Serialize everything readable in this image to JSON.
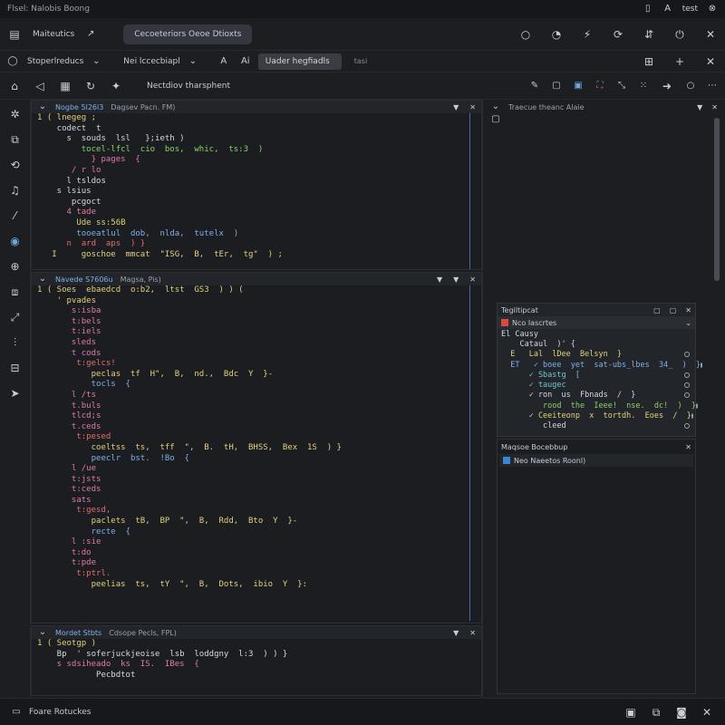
{
  "window": {
    "title": "Flsel: Nalobis Boong",
    "controls": [
      "▯",
      "A",
      "test",
      "⊗"
    ]
  },
  "menubar": {
    "label": "Maiteutics",
    "arrow_icon": "arrow-icon",
    "tab": "Cecoeteriors Oeoe Dtioxts"
  },
  "toolbar1": {
    "dropdown": "Stoperlreducs",
    "field_label": "Nei lccecbiapl",
    "input_value": "Uader hegfiadls",
    "extra": "tasi"
  },
  "toolbar2": {
    "label": "Nectdiov tharsphent"
  },
  "panes": [
    {
      "tab": "Nogbe 5l26l3",
      "info": "Dagsev  Pacn.  FM)",
      "lines": [
        [
          {
            "t": "1 ( lnegeg ;",
            "c": "c-yellow"
          }
        ],
        [
          {
            "t": "    codect  t",
            "c": "c-white"
          }
        ],
        [
          {
            "t": "      s  souds  lsl   };ieth )",
            "c": "c-white"
          }
        ],
        [
          {
            "t": "         tocel-lfcl  cio  bos,  whic,  ts:3  )",
            "c": "c-green"
          }
        ],
        [
          {
            "t": "           } pages  {",
            "c": "c-pink"
          }
        ],
        [
          {
            "t": "       / r lo",
            "c": "c-pink"
          }
        ],
        [
          {
            "t": "      l tsldos",
            "c": "c-white"
          }
        ],
        [
          {
            "t": "    s lsius",
            "c": "c-white"
          }
        ],
        [
          {
            "t": "       pcgoct",
            "c": "c-white"
          }
        ],
        [
          {
            "t": "      4 tade",
            "c": "c-pink"
          }
        ],
        [
          {
            "t": "        Ude ss:56B",
            "c": "c-yellow"
          }
        ],
        [
          {
            "t": "        tooeatlul  dob,  nlda,  tutelx  )",
            "c": "c-blue"
          }
        ],
        [
          {
            "t": "      n  ard  aps  ) }",
            "c": "c-red"
          }
        ],
        [
          {
            "t": "   I     goschoe  mmcat  \"ISG,  B,  tEr,  tg\"  ) ;",
            "c": "c-yellow"
          }
        ]
      ]
    },
    {
      "tab": "Navede S7606u",
      "info": "Magsa,  Pis)",
      "lines": [
        [
          {
            "t": "1 ( Soes  ebaedcd  o:b2,  ltst  GS3  ) ) (",
            "c": "c-yellow"
          }
        ],
        [
          {
            "t": "    ' pvades",
            "c": "c-yellow"
          }
        ],
        [
          {
            "t": "       s:isba",
            "c": "c-pink"
          }
        ],
        [
          {
            "t": "       t:bels",
            "c": "c-pink"
          }
        ],
        [
          {
            "t": "       t:iels",
            "c": "c-pink"
          }
        ],
        [
          {
            "t": "       sleds",
            "c": "c-pink"
          }
        ],
        [
          {
            "t": "       t cods",
            "c": "c-pink"
          }
        ],
        [
          {
            "t": "        t:gelcs!",
            "c": "c-red"
          }
        ],
        [
          {
            "t": "           peclas  tf  H\",  B,  nd.,  Bdc  Y  }-",
            "c": "c-yellow"
          }
        ],
        [
          {
            "t": "           tocls  {",
            "c": "c-blue"
          }
        ],
        [
          {
            "t": "       l /ts",
            "c": "c-pink"
          }
        ],
        [
          {
            "t": "       t.buls",
            "c": "c-pink"
          }
        ],
        [
          {
            "t": "       tlcd;s",
            "c": "c-pink"
          }
        ],
        [
          {
            "t": "       t.ceds",
            "c": "c-pink"
          }
        ],
        [
          {
            "t": "        t:pesed",
            "c": "c-red"
          }
        ],
        [
          {
            "t": "           coeltss  ts,  tff  \",  B.  tH,  BHSS,  Bex  1S  ) }",
            "c": "c-yellow"
          }
        ],
        [
          {
            "t": "           peeclr  bst.  !Bo  {",
            "c": "c-blue"
          }
        ],
        [
          {
            "t": "       l /ue",
            "c": "c-pink"
          }
        ],
        [
          {
            "t": "       t:jsts",
            "c": "c-pink"
          }
        ],
        [
          {
            "t": "       t:ceds",
            "c": "c-pink"
          }
        ],
        [
          {
            "t": "       sats",
            "c": "c-pink"
          }
        ],
        [
          {
            "t": "        t:gesd,",
            "c": "c-red"
          }
        ],
        [
          {
            "t": "           paclets  tB,  BP  \",  B,  Rdd,  Bto  Y  }-",
            "c": "c-yellow"
          }
        ],
        [
          {
            "t": "           recte  {",
            "c": "c-blue"
          }
        ],
        [
          {
            "t": "       l :sie",
            "c": "c-pink"
          }
        ],
        [
          {
            "t": "       t:do",
            "c": "c-pink"
          }
        ],
        [
          {
            "t": "       t:pde",
            "c": "c-pink"
          }
        ],
        [
          {
            "t": "        t:ptrl.",
            "c": "c-red"
          }
        ],
        [
          {
            "t": "           peelias  ts,  tY  \",  B,  Dots,  ibio  Y  }:",
            "c": "c-yellow"
          }
        ]
      ]
    },
    {
      "tab": "Mordet Stbts",
      "info": "Cdsope  Pecls,  FPL)",
      "lines": [
        [
          {
            "t": "1 ( Seotgp )",
            "c": "c-yellow"
          }
        ],
        [
          {
            "t": "    Bp  ' soferjuckjeoise  lsb  loddgny  l:3  ) ) }",
            "c": "c-white"
          }
        ],
        [
          {
            "t": "    s sdsiheado  ks  IS.  IBes  {",
            "c": "c-pink"
          }
        ],
        [
          {
            "t": "            Pecbdtot",
            "c": "c-white"
          }
        ]
      ]
    }
  ],
  "rightpanel": {
    "title": "Traecue theanc Alaie"
  },
  "floatpanel": {
    "title": "Tegiltipcat",
    "section": "Nco Iascrtes",
    "rows": [
      {
        "t": "El Causy",
        "c": "c-white",
        "dot": false
      },
      {
        "t": "    Cataul  )' {",
        "c": "c-white",
        "dot": false
      },
      {
        "t": "  E   Lal  lDee  Belsyn  }",
        "c": "c-yellow",
        "dot": true
      },
      {
        "t": "  ET   ✓ boee  yet  sat-ubs_lbes  34_  )  }",
        "c": "c-blue",
        "dot": true
      },
      {
        "t": "      ✓ Sbastg  [",
        "c": "c-cyan",
        "dot": true
      },
      {
        "t": "      ✓ taugec",
        "c": "c-cyan",
        "dot": true
      },
      {
        "t": "      ✓ ron  us  Fbnads  /  }",
        "c": "c-white",
        "dot": true
      },
      {
        "t": "         rood  the  Ieee!  nse.  dc!  )  }",
        "c": "c-green",
        "dot": true
      },
      {
        "t": "      ✓ Ceeiteonp  x  tortdh.  Eoes  /  }",
        "c": "c-yellow",
        "dot": true
      },
      {
        "t": "         cleed",
        "c": "c-white",
        "dot": true
      }
    ]
  },
  "sidepanel2": {
    "title": "Maqsoe  Bocebbup",
    "item": "Neo  Naeetos  Roonl)"
  },
  "statusbar": {
    "label": "Foare  Rotuckes"
  }
}
